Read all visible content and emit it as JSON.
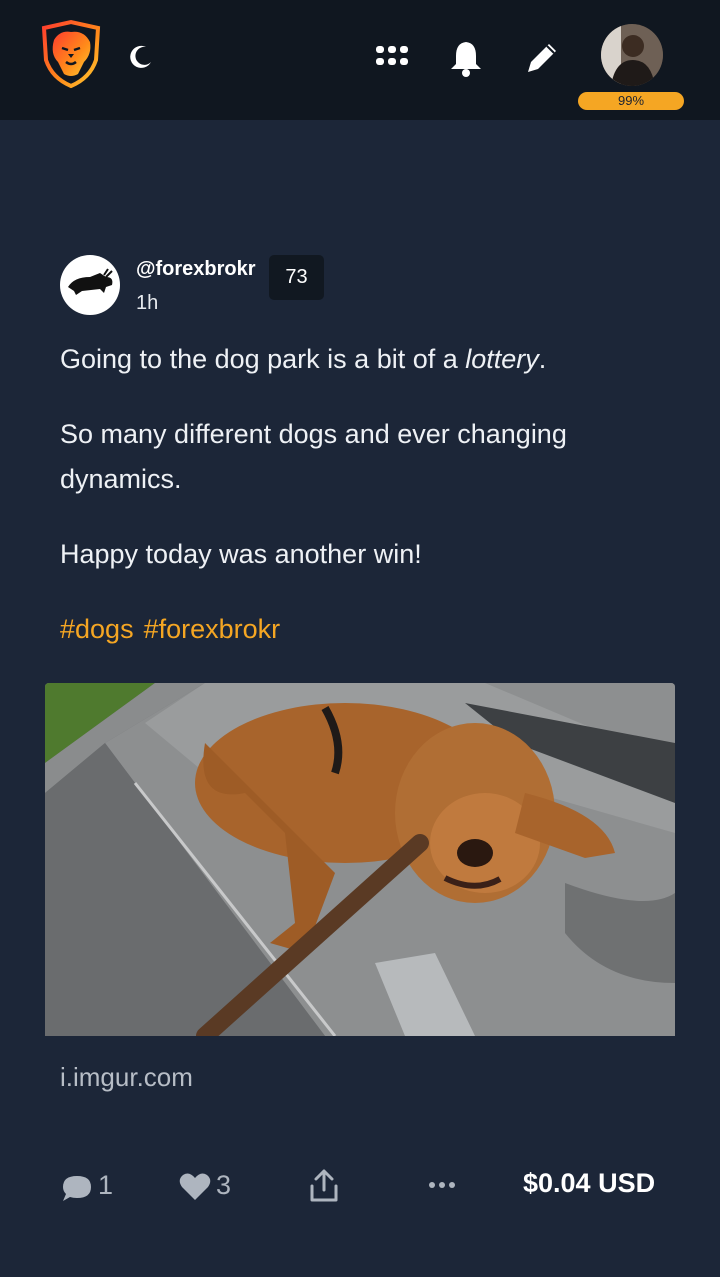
{
  "header": {
    "logo_icon": "lion-logo-icon",
    "theme_icon": "moon-icon",
    "apps_icon": "grid-icon",
    "notifications_icon": "bell-icon",
    "compose_icon": "pencil-icon",
    "rc_percent": "99%"
  },
  "post": {
    "author": "@forexbrokr",
    "reputation": "73",
    "time": "1h",
    "paragraphs": {
      "p1_before": "Going to the dog park is a bit of a ",
      "p1_italic": "lottery",
      "p1_after": ".",
      "p2": "So many different dogs and ever changing dynamics.",
      "p3": "Happy today was another win!"
    },
    "tags": [
      "#dogs",
      "#forexbrokr"
    ],
    "image_alt": "Dog lying on stone steps chewing a stick",
    "link_domain": "i.imgur.com"
  },
  "footer": {
    "comments": "1",
    "likes": "3",
    "payout": "$0.04 USD"
  },
  "colors": {
    "background": "#1c2638",
    "topbar": "#101720",
    "accent": "#f5a623"
  }
}
